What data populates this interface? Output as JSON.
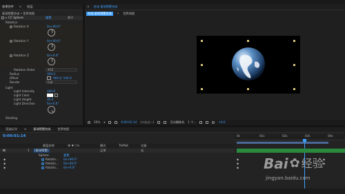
{
  "left_panel": {
    "tabs": [
      {
        "label": "效果控件"
      },
      {
        "label": "图层"
      }
    ],
    "close_glyph": "×",
    "breadcrumb": "星球预置合成 • 世界地图",
    "effect_name": "CC Sphere",
    "reset_label": "重置",
    "about_label": "关于",
    "group_rotation": "Rotation",
    "rotations": [
      {
        "label": "Rotation X",
        "value": "0x+90.0°"
      },
      {
        "label": "Rotation Y",
        "value": "0x+00.0°"
      },
      {
        "label": "Rotation Z",
        "value": "0x+0.0°"
      }
    ],
    "rotation_order_label": "Rotation Order",
    "rotation_order_value": "XYZ",
    "radius_label": "Radius",
    "radius_value": "300.0",
    "offset_label": "Offset",
    "offset_value": "960.0, 540.0",
    "render_label": "Render",
    "render_value": "Full",
    "light_label": "Light",
    "light_intensity_label": "Light Intensity",
    "light_intensity_value": "100.0",
    "light_color_label": "Light Color",
    "light_height_label": "Light Height",
    "light_height_value": "35.0",
    "light_direction_label": "Light Direction",
    "light_direction_value": "0x+0.0°",
    "shading_label": "Shading"
  },
  "composition_panel": {
    "tabs": [
      {
        "label": "合成 星球预置合成"
      },
      {
        "label": "世界地图"
      }
    ],
    "zoom": "50%",
    "timecode": "0:00:01:14",
    "resolution": "(二分之一)",
    "camera": "活动摄像机",
    "views": "1 个...",
    "exposure": "+0.0",
    "dropdown_glyph": "▾"
  },
  "timeline": {
    "tabs": [
      {
        "label": "渲染队列"
      },
      {
        "label": "星球预置合成"
      },
      {
        "label": "世界地图"
      }
    ],
    "timecode": "0:00:01:14",
    "columns": {
      "source_name": "图层名称",
      "mode": "模式",
      "trkmat": "TrkMat",
      "parent": "父级",
      "switches": "单 ✱ \\ fx"
    },
    "layers": [
      {
        "number": "1",
        "name": "[星球预置]",
        "mode": "正常",
        "parent": "无"
      }
    ],
    "effect_rows": [
      {
        "label": "Rotatio...",
        "value": "0x+90.0°"
      },
      {
        "label": "Rotatio...",
        "value": "0x+00.0°"
      },
      {
        "label": "Rotatio...",
        "value": "0x+0.0°"
      }
    ],
    "effect_head": "Sphere",
    "effect_reset": "重置",
    "ruler_marks": [
      "0s",
      "01s",
      "02s",
      "03s",
      "04s"
    ]
  },
  "watermark": {
    "brand": "Bai",
    "brand2": "经验",
    "url": "jingyan.baidu.com"
  },
  "colors": {
    "accent": "#3ea0ff",
    "panel": "#232323",
    "work_area": "#2b8a3e",
    "keyframe": "#c9c9c9"
  }
}
